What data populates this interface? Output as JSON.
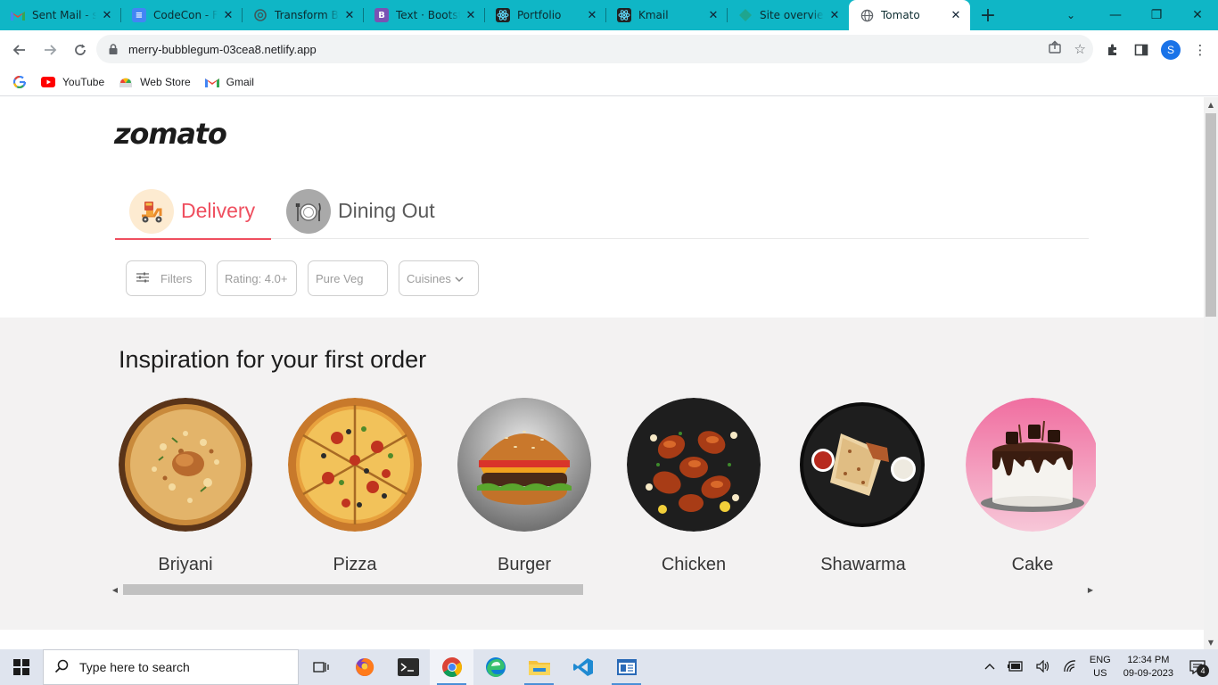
{
  "browser": {
    "tabs": [
      {
        "title": "Sent Mail - sa",
        "icon": "gmail-icon"
      },
      {
        "title": "CodeCon - Fr",
        "icon": "docs-icon"
      },
      {
        "title": "Transform Bo",
        "icon": "chatgpt-icon"
      },
      {
        "title": "Text · Bootstr",
        "icon": "bootstrap-icon"
      },
      {
        "title": "Portfolio",
        "icon": "react-icon"
      },
      {
        "title": "Kmail",
        "icon": "react-icon"
      },
      {
        "title": "Site overview",
        "icon": "netlify-icon"
      },
      {
        "title": "Tomato",
        "icon": "globe-icon",
        "active": true
      }
    ],
    "url": "merry-bubblegum-03cea8.netlify.app",
    "profile_initial": "S",
    "bookmarks": [
      {
        "label": "",
        "icon": "google-icon"
      },
      {
        "label": "YouTube",
        "icon": "youtube-icon"
      },
      {
        "label": "Web Store",
        "icon": "webstore-icon"
      },
      {
        "label": "Gmail",
        "icon": "gmail-icon"
      }
    ],
    "accent": "#0fb6c6"
  },
  "page": {
    "logo": "zomato",
    "modes": [
      {
        "label": "Delivery",
        "active": true
      },
      {
        "label": "Dining Out",
        "active": false
      }
    ],
    "filters": [
      "Filters",
      "Rating: 4.0+",
      "Pure Veg",
      "Cuisines"
    ],
    "inspiration_title": "Inspiration for your first order",
    "foods": [
      "Briyani",
      "Pizza",
      "Burger",
      "Chicken",
      "Shawarma",
      "Cake"
    ],
    "brand_color": "#ef4f5f"
  },
  "taskbar": {
    "search_placeholder": "Type here to search",
    "lang_top": "ENG",
    "lang_bottom": "US",
    "time": "12:34 PM",
    "date": "09-09-2023",
    "notification_count": "4"
  }
}
